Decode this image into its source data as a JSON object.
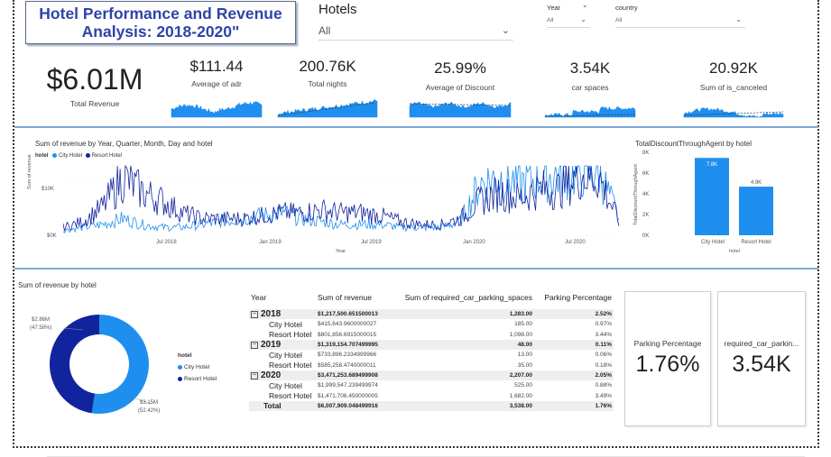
{
  "header": {
    "title": "Hotel Performance and Revenue Analysis: 2018-2020\""
  },
  "slicers": {
    "hotels": {
      "label": "Hotels",
      "value": "All"
    },
    "year": {
      "label": "Year",
      "value": "All"
    },
    "country": {
      "label": "country",
      "value": "All"
    }
  },
  "kpis": {
    "total_revenue": {
      "value": "$6.01M",
      "label": "Total Revenue"
    },
    "adr": {
      "value": "$111.44",
      "label": "Average of adr"
    },
    "nights": {
      "value": "200.76K",
      "label": "Total nights"
    },
    "discount": {
      "value": "25.99%",
      "label": "Average of Discount"
    },
    "car": {
      "value": "3.54K",
      "label": "car spaces"
    },
    "canceled": {
      "value": "20.92K",
      "label": "Sum of is_canceled"
    }
  },
  "line_chart": {
    "title": "Sum of revenue by Year, Quarter, Month, Day and hotel",
    "legend_title": "hotel",
    "legend": [
      {
        "name": "City Hotel",
        "color": "#1f8fef"
      },
      {
        "name": "Resort Hotel",
        "color": "#12239e"
      }
    ],
    "ylabel": "Sum of revenue",
    "xlabel": "Year",
    "yticks": [
      "$10K",
      "$0K"
    ],
    "xticks": [
      "Jul 2018",
      "Jan 2019",
      "Jul 2019",
      "Jan 2020",
      "Jul 2020"
    ]
  },
  "bar_chart": {
    "title": "TotalDiscountThroughAgent by hotel",
    "ylabel": "TotalDiscountThroughAgent",
    "xlabel": "hotel",
    "yticks": [
      "8K",
      "6K",
      "4K",
      "2K",
      "0K"
    ],
    "bars": [
      {
        "label": "City Hotel",
        "value_label": "7.8K"
      },
      {
        "label": "Resort Hotel",
        "value_label": "4.9K"
      }
    ]
  },
  "donut": {
    "title": "Sum of revenue by hotel",
    "legend_title": "hotel",
    "legend": [
      {
        "name": "City Hotel",
        "color": "#1f8fef"
      },
      {
        "name": "Resort Hotel",
        "color": "#12239e"
      }
    ],
    "resort_label": "$2.86M",
    "resort_pct": "(47.58%)",
    "city_label": "$3.15M",
    "city_pct": "(52.42%)"
  },
  "matrix": {
    "headers": [
      "Year",
      "Sum of revenue",
      "Sum of required_car_parking_spaces",
      "Parking Percentage"
    ],
    "rows": [
      {
        "kind": "year",
        "label": "2018",
        "revenue": "$1,217,500.651500013",
        "parking": "1,283.00",
        "pct": "2.52%"
      },
      {
        "kind": "hotel",
        "label": "City Hotel",
        "revenue": "$415,643.9600000027",
        "parking": "185.00",
        "pct": "0.97%"
      },
      {
        "kind": "hotel",
        "label": "Resort Hotel",
        "revenue": "$801,856.6915000015",
        "parking": "1,098.00",
        "pct": "3.44%"
      },
      {
        "kind": "year",
        "label": "2019",
        "revenue": "$1,319,154.707499995",
        "parking": "48.00",
        "pct": "0.11%"
      },
      {
        "kind": "hotel",
        "label": "City Hotel",
        "revenue": "$733,896.2334999966",
        "parking": "13.00",
        "pct": "0.06%"
      },
      {
        "kind": "hotel",
        "label": "Resort Hotel",
        "revenue": "$585,258.4740000011",
        "parking": "35.00",
        "pct": "0.18%"
      },
      {
        "kind": "year",
        "label": "2020",
        "revenue": "$3,471,253.689499908",
        "parking": "2,207.00",
        "pct": "2.05%"
      },
      {
        "kind": "hotel",
        "label": "City Hotel",
        "revenue": "$1,999,547.239499974",
        "parking": "525.00",
        "pct": "0.88%"
      },
      {
        "kind": "hotel",
        "label": "Resort Hotel",
        "revenue": "$1,471,706.450000005",
        "parking": "1,682.00",
        "pct": "3.49%"
      },
      {
        "kind": "total",
        "label": "Total",
        "revenue": "$6,007,909.048499916",
        "parking": "3,538.00",
        "pct": "1.76%"
      }
    ]
  },
  "cards": {
    "parking_pct": {
      "label": "Parking Percentage",
      "value": "1.76%"
    },
    "car_parking": {
      "label": "required_car_parkin...",
      "value": "3.54K"
    }
  },
  "chart_data": [
    {
      "type": "bar",
      "title": "TotalDiscountThroughAgent by hotel",
      "xlabel": "hotel",
      "ylabel": "TotalDiscountThroughAgent",
      "categories": [
        "City Hotel",
        "Resort Hotel"
      ],
      "values": [
        7800,
        4900
      ],
      "ylim": [
        0,
        8000
      ],
      "color": "#1f8fef"
    },
    {
      "type": "pie",
      "title": "Sum of revenue by hotel",
      "categories": [
        "City Hotel",
        "Resort Hotel"
      ],
      "values": [
        3.15,
        2.86
      ],
      "percentages": [
        52.42,
        47.58
      ],
      "colors": [
        "#1f8fef",
        "#12239e"
      ]
    },
    {
      "type": "line",
      "title": "Sum of revenue by Year, Quarter, Month, Day and hotel",
      "xlabel": "Year",
      "ylabel": "Sum of revenue",
      "x": [
        "2018-04",
        "2018-06",
        "2018-07",
        "2018-08",
        "2018-09",
        "2018-10",
        "2018-11",
        "2018-12",
        "2019-01",
        "2019-02",
        "2019-03",
        "2019-04",
        "2019-05",
        "2019-06",
        "2019-07",
        "2019-08",
        "2019-09",
        "2019-10",
        "2019-11",
        "2019-12",
        "2020-01",
        "2020-02",
        "2020-03",
        "2020-04",
        "2020-05",
        "2020-06",
        "2020-07",
        "2020-08",
        "2020-09"
      ],
      "series": [
        {
          "name": "City Hotel",
          "values": [
            1.0,
            1.5,
            2.0,
            3.0,
            2.0,
            1.5,
            1.5,
            2.0,
            2.5,
            3.0,
            3.5,
            4.0,
            3.0,
            2.5,
            2.0,
            2.0,
            2.0,
            1.5,
            1.5,
            1.5,
            2.5,
            9.0,
            10.0,
            9.0,
            10.0,
            10.5,
            11.0,
            11.0,
            3.0
          ]
        },
        {
          "name": "Resort Hotel",
          "values": [
            1.5,
            2.5,
            5.0,
            10.0,
            7.5,
            6.0,
            4.0,
            3.0,
            3.0,
            3.0,
            3.5,
            4.0,
            4.0,
            4.5,
            4.0,
            4.0,
            3.5,
            2.5,
            2.0,
            2.0,
            3.0,
            6.0,
            7.5,
            6.5,
            8.0,
            8.0,
            10.5,
            10.0,
            2.5
          ]
        }
      ],
      "yticks": [
        "$0K",
        "$10K"
      ]
    }
  ]
}
